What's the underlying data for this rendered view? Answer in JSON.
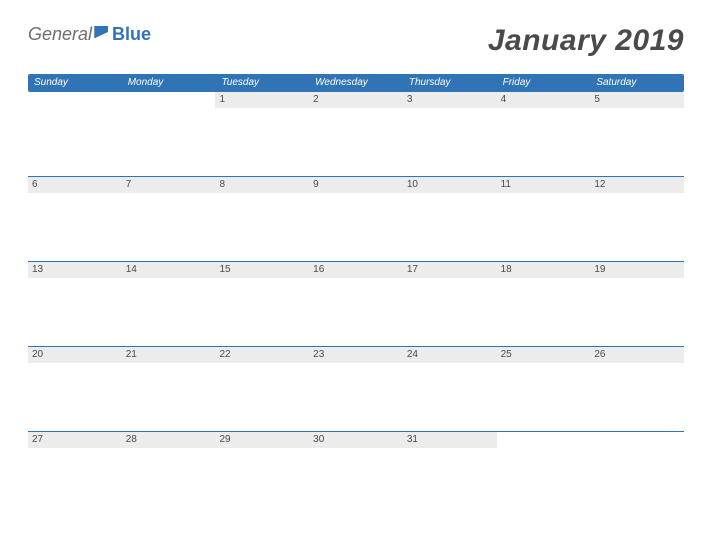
{
  "logo": {
    "general": "General",
    "blue": "Blue"
  },
  "title": "January 2019",
  "dayHeaders": [
    "Sunday",
    "Monday",
    "Tuesday",
    "Wednesday",
    "Thursday",
    "Friday",
    "Saturday"
  ],
  "weeks": [
    [
      "",
      "",
      "1",
      "2",
      "3",
      "4",
      "5"
    ],
    [
      "6",
      "7",
      "8",
      "9",
      "10",
      "11",
      "12"
    ],
    [
      "13",
      "14",
      "15",
      "16",
      "17",
      "18",
      "19"
    ],
    [
      "20",
      "21",
      "22",
      "23",
      "24",
      "25",
      "26"
    ],
    [
      "27",
      "28",
      "29",
      "30",
      "31",
      "",
      ""
    ]
  ]
}
